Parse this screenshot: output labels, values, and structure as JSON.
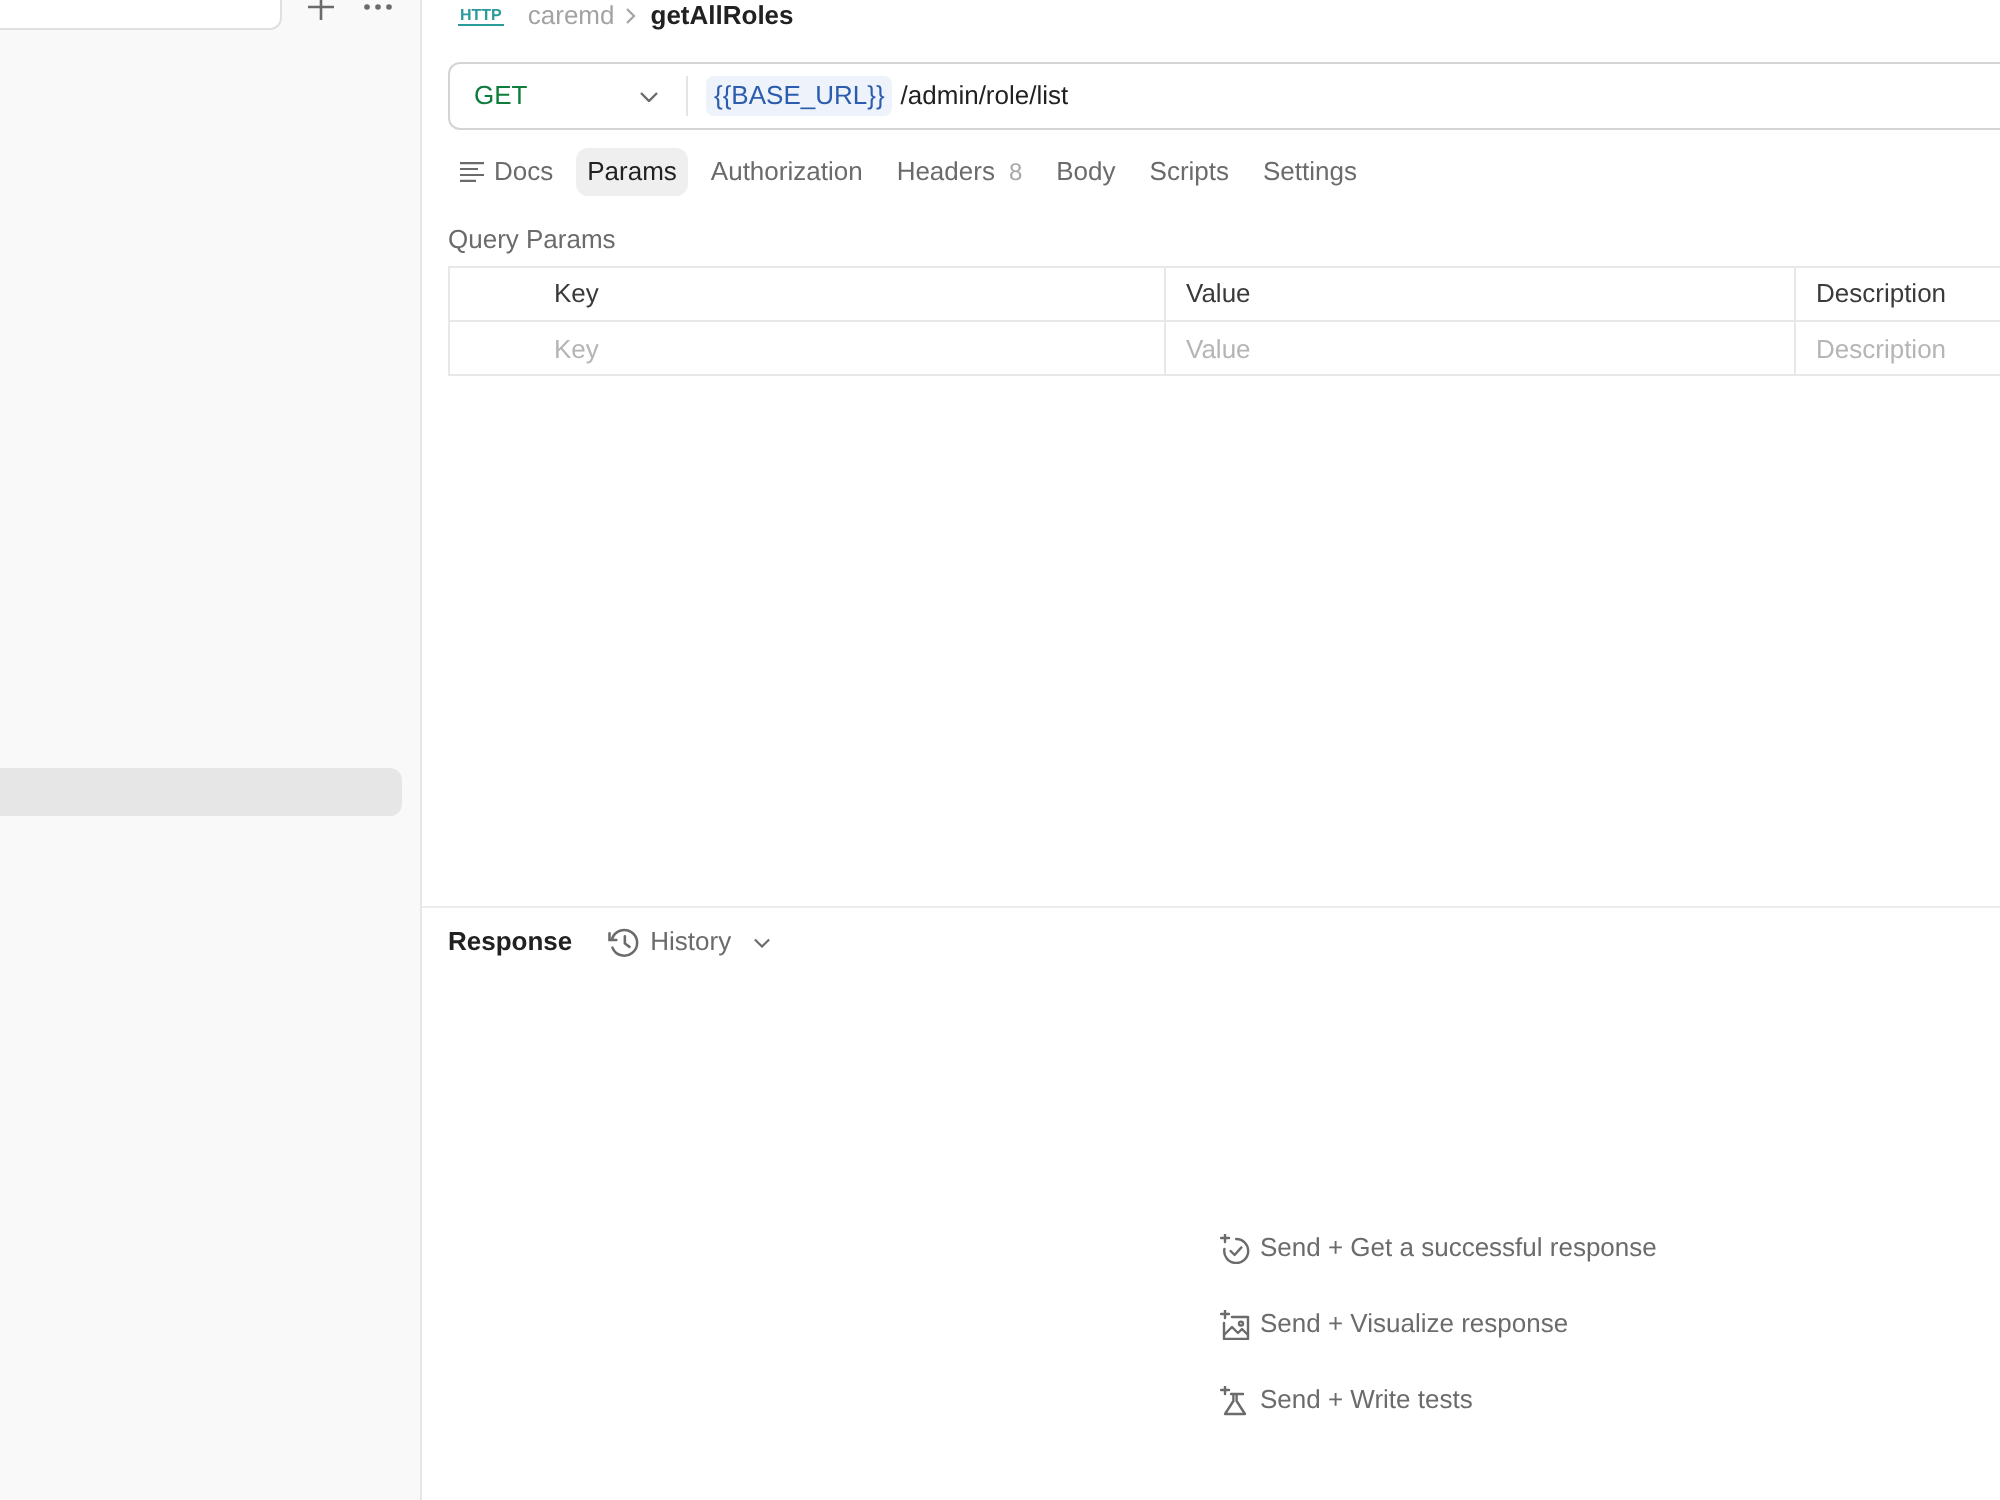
{
  "sidebar": {
    "items": [
      {
        "selected": true
      }
    ]
  },
  "breadcrumb": {
    "badge": "HTTP",
    "collection": "caremd",
    "request": "getAllRoles"
  },
  "request": {
    "method": "GET",
    "url_variable": "{{BASE_URL}}",
    "url_path": "/admin/role/list"
  },
  "tabs": [
    {
      "label": "Docs",
      "kind": "docs",
      "selected": false
    },
    {
      "label": "Params",
      "kind": "tab",
      "selected": true
    },
    {
      "label": "Authorization",
      "kind": "tab",
      "selected": false
    },
    {
      "label": "Headers",
      "kind": "tab",
      "selected": false,
      "count": "8"
    },
    {
      "label": "Body",
      "kind": "tab",
      "selected": false
    },
    {
      "label": "Scripts",
      "kind": "tab",
      "selected": false
    },
    {
      "label": "Settings",
      "kind": "tab",
      "selected": false
    }
  ],
  "query_params": {
    "title": "Query Params",
    "columns": [
      "Key",
      "Value",
      "Description"
    ],
    "new_row": [
      {
        "placeholder": "Key"
      },
      {
        "placeholder": "Value"
      },
      {
        "placeholder": "Description"
      }
    ]
  },
  "response": {
    "title": "Response",
    "history": "History",
    "suggestions": [
      {
        "kind": "success",
        "label": "Send + Get a successful response"
      },
      {
        "kind": "visualize",
        "label": "Send + Visualize response"
      },
      {
        "kind": "tests",
        "label": "Send + Write tests"
      }
    ]
  }
}
